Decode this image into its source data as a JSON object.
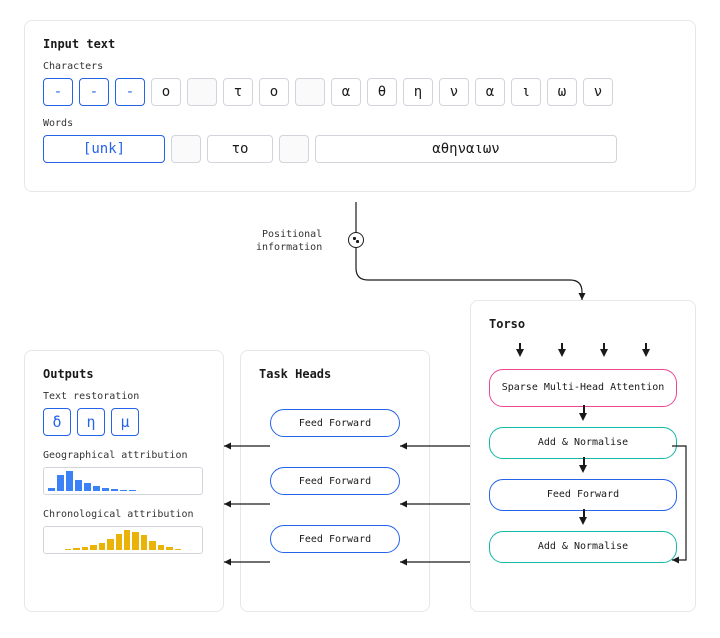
{
  "input": {
    "title": "Input text",
    "chars_label": "Characters",
    "chars": [
      {
        "v": "-",
        "blue": true
      },
      {
        "v": "-",
        "blue": true
      },
      {
        "v": "-",
        "blue": true
      },
      {
        "v": "ο"
      },
      {
        "v": "",
        "empty": true
      },
      {
        "v": "τ"
      },
      {
        "v": "ο"
      },
      {
        "v": "",
        "empty": true
      },
      {
        "v": "α"
      },
      {
        "v": "θ"
      },
      {
        "v": "η"
      },
      {
        "v": "ν"
      },
      {
        "v": "α"
      },
      {
        "v": "ι"
      },
      {
        "v": "ω"
      },
      {
        "v": "ν"
      }
    ],
    "words_label": "Words",
    "words": {
      "unk": "[unk]",
      "w2": "το",
      "w3": "αθηναιων"
    }
  },
  "positional": {
    "l1": "Positional",
    "l2": "information"
  },
  "torso": {
    "title": "Torso",
    "attention": "Sparse Multi-Head Attention",
    "addnorm": "Add & Normalise",
    "ff": "Feed Forward"
  },
  "heads": {
    "title": "Task Heads",
    "ff": "Feed Forward"
  },
  "outputs": {
    "title": "Outputs",
    "restoration_label": "Text restoration",
    "restoration": [
      "δ",
      "η",
      "μ"
    ],
    "geo_label": "Geographical attribution",
    "chrono_label": "Chronological attribution"
  },
  "chart_data": [
    {
      "type": "bar",
      "title": "Geographical attribution",
      "values": [
        3,
        18,
        22,
        12,
        9,
        5,
        3,
        2,
        1,
        1
      ],
      "ylim": [
        0,
        24
      ]
    },
    {
      "type": "bar",
      "title": "Chronological attribution",
      "values": [
        0,
        0,
        1,
        2,
        3,
        5,
        8,
        12,
        18,
        22,
        20,
        16,
        10,
        6,
        3,
        1,
        0,
        0
      ],
      "ylim": [
        0,
        24
      ]
    }
  ]
}
